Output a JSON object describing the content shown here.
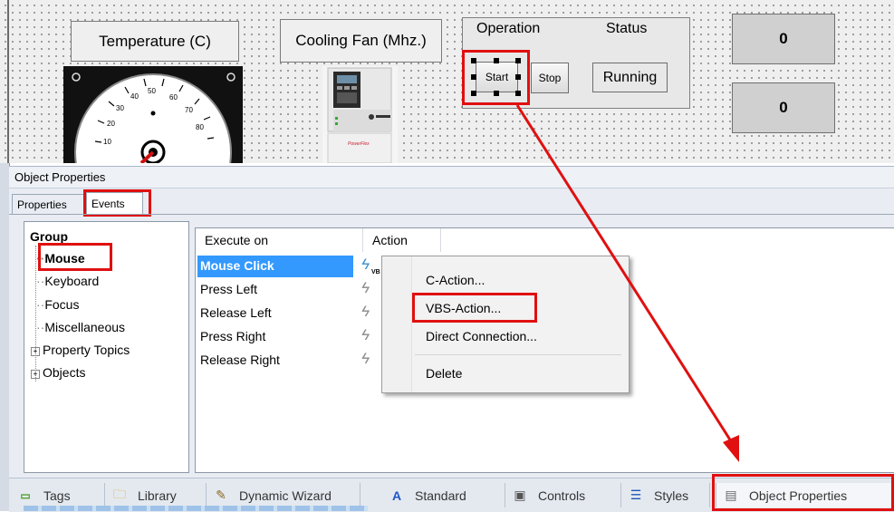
{
  "canvas": {
    "temperature_label": "Temperature (C)",
    "cooling_fan_label": "Cooling Fan (Mhz.)",
    "operation_label": "Operation",
    "status_label": "Status",
    "start_button": "Start",
    "stop_button": "Stop",
    "running_label": "Running",
    "value_top": "0",
    "value_bottom": "0",
    "gauge_ticks": [
      "10",
      "20",
      "30",
      "40",
      "50",
      "60",
      "70",
      "80"
    ],
    "drive_brand": "PowerFlex"
  },
  "panel": {
    "title": "Object Properties",
    "tabs": [
      "Properties",
      "Events"
    ],
    "active_tab": "Events",
    "tree": {
      "header": "Group",
      "items": [
        "Mouse",
        "Keyboard",
        "Focus",
        "Miscellaneous",
        "Property Topics",
        "Objects"
      ],
      "selected": "Mouse"
    },
    "columns": [
      "Execute on",
      "Action"
    ],
    "rows": [
      "Mouse Click",
      "Press Left",
      "Release Left",
      "Press Right",
      "Release Right"
    ],
    "selected_row": "Mouse Click",
    "vb_badge": "VB"
  },
  "context_menu": {
    "items": [
      "C-Action...",
      "VBS-Action...",
      "Direct Connection...",
      "Delete"
    ],
    "highlighted": "VBS-Action..."
  },
  "bottom_tabs": [
    "Tags",
    "Library",
    "Dynamic Wizard",
    "Standard",
    "Controls",
    "Styles",
    "Object Properties"
  ],
  "colors": {
    "highlight_red": "#e01010",
    "selection_blue": "#3399ff"
  }
}
